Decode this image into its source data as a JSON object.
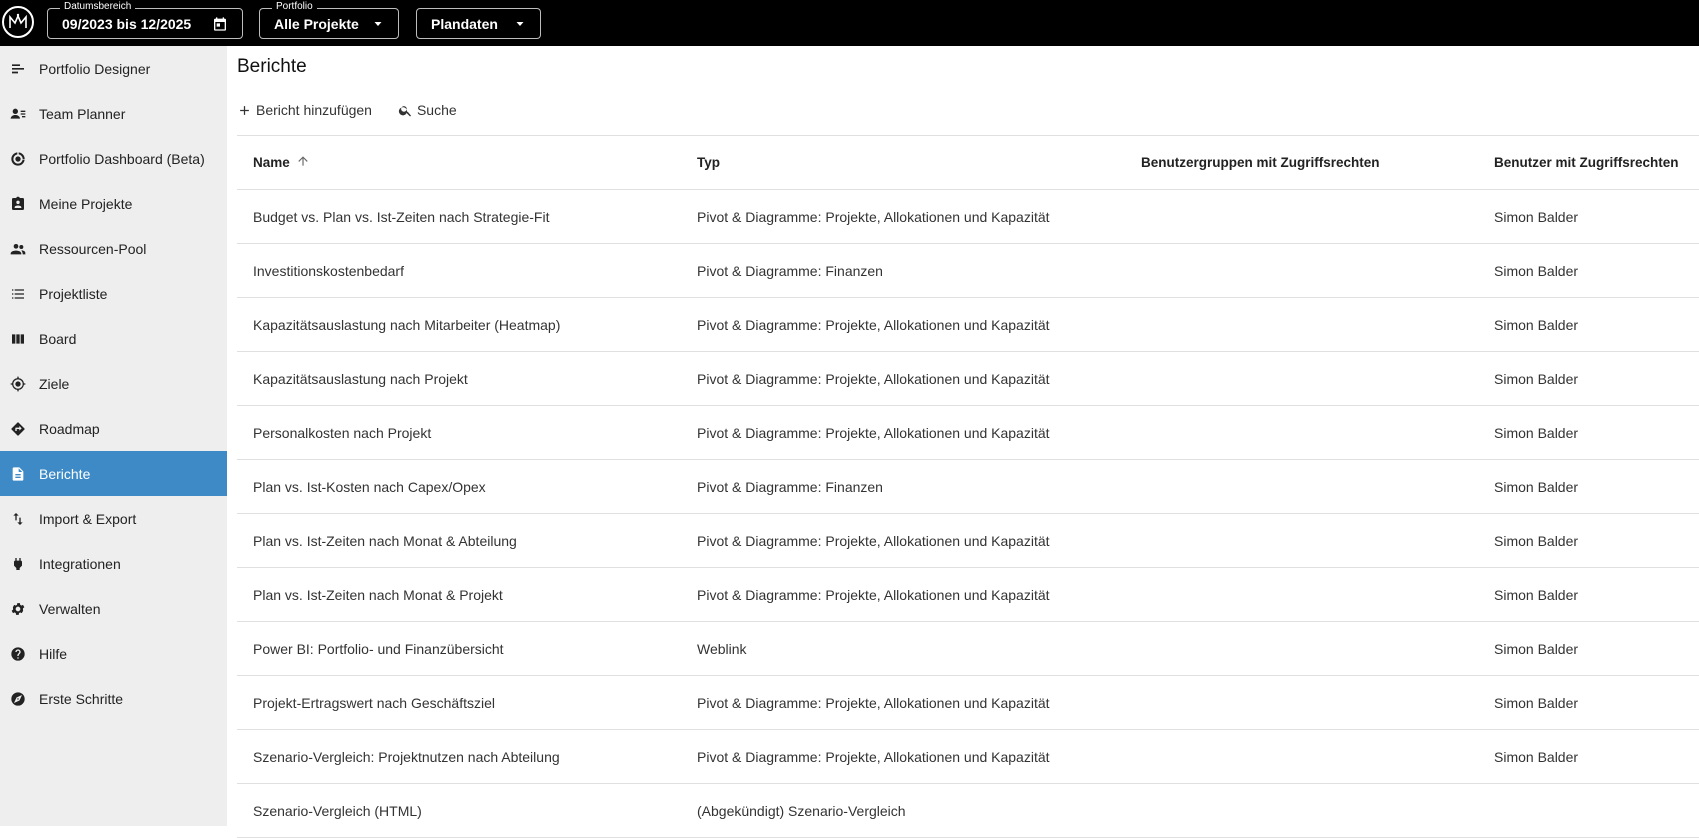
{
  "topbar": {
    "logo_icon": "monogram-logo-icon",
    "date_range": {
      "legend": "Datumsbereich",
      "value": "09/2023 bis 12/2025",
      "icon": "calendar-icon"
    },
    "portfolio": {
      "legend": "Portfolio",
      "value": "Alle Projekte",
      "icon": "dropdown-arrow-icon"
    },
    "plandata": {
      "value": "Plandaten",
      "icon": "dropdown-arrow-icon"
    }
  },
  "sidebar": {
    "items": [
      {
        "label": "Portfolio Designer",
        "icon": "portfolio-designer-icon"
      },
      {
        "label": "Team Planner",
        "icon": "team-planner-icon"
      },
      {
        "label": "Portfolio Dashboard (Beta)",
        "icon": "dashboard-icon"
      },
      {
        "label": "Meine Projekte",
        "icon": "my-projects-icon"
      },
      {
        "label": "Ressourcen-Pool",
        "icon": "people-icon"
      },
      {
        "label": "Projektliste",
        "icon": "list-icon"
      },
      {
        "label": "Board",
        "icon": "board-icon"
      },
      {
        "label": "Ziele",
        "icon": "target-icon"
      },
      {
        "label": "Roadmap",
        "icon": "roadmap-icon"
      },
      {
        "label": "Berichte",
        "icon": "report-icon",
        "active": true
      },
      {
        "label": "Import & Export",
        "icon": "import-export-icon"
      },
      {
        "label": "Integrationen",
        "icon": "plug-icon"
      },
      {
        "label": "Verwalten",
        "icon": "gear-icon"
      },
      {
        "label": "Hilfe",
        "icon": "help-icon"
      },
      {
        "label": "Erste Schritte",
        "icon": "compass-icon"
      }
    ],
    "active_color": "#3d8ac7"
  },
  "main": {
    "title": "Berichte",
    "toolbar": {
      "add_label": "Bericht hinzufügen",
      "search_label": "Suche"
    },
    "table": {
      "columns": [
        "Name",
        "Typ",
        "Benutzergruppen mit Zugriffsrechten",
        "Benutzer mit Zugriffsrechten"
      ],
      "sort": {
        "column": "Name",
        "direction": "ascending",
        "icon": "arrow-up-icon"
      },
      "rows": [
        {
          "name": "Budget vs. Plan vs. Ist-Zeiten nach Strategie-Fit",
          "type": "Pivot & Diagramme: Projekte, Allokationen und Kapazität",
          "groups": "",
          "users": "Simon Balder"
        },
        {
          "name": "Investitionskostenbedarf",
          "type": "Pivot & Diagramme: Finanzen",
          "groups": "",
          "users": "Simon Balder"
        },
        {
          "name": "Kapazitätsauslastung nach Mitarbeiter (Heatmap)",
          "type": "Pivot & Diagramme: Projekte, Allokationen und Kapazität",
          "groups": "",
          "users": "Simon Balder"
        },
        {
          "name": "Kapazitätsauslastung nach Projekt",
          "type": "Pivot & Diagramme: Projekte, Allokationen und Kapazität",
          "groups": "",
          "users": "Simon Balder"
        },
        {
          "name": "Personalkosten nach Projekt",
          "type": "Pivot & Diagramme: Projekte, Allokationen und Kapazität",
          "groups": "",
          "users": "Simon Balder"
        },
        {
          "name": "Plan vs. Ist-Kosten nach Capex/Opex",
          "type": "Pivot & Diagramme: Finanzen",
          "groups": "",
          "users": "Simon Balder"
        },
        {
          "name": "Plan vs. Ist-Zeiten nach Monat & Abteilung",
          "type": "Pivot & Diagramme: Projekte, Allokationen und Kapazität",
          "groups": "",
          "users": "Simon Balder"
        },
        {
          "name": "Plan vs. Ist-Zeiten nach Monat & Projekt",
          "type": "Pivot & Diagramme: Projekte, Allokationen und Kapazität",
          "groups": "",
          "users": "Simon Balder"
        },
        {
          "name": "Power BI: Portfolio- und Finanzübersicht",
          "type": "Weblink",
          "groups": "",
          "users": "Simon Balder"
        },
        {
          "name": "Projekt-Ertragswert nach Geschäftsziel",
          "type": "Pivot & Diagramme: Projekte, Allokationen und Kapazität",
          "groups": "",
          "users": "Simon Balder"
        },
        {
          "name": "Szenario-Vergleich: Projektnutzen nach Abteilung",
          "type": "Pivot & Diagramme: Projekte, Allokationen und Kapazität",
          "groups": "",
          "users": "Simon Balder"
        },
        {
          "name": "Szenario-Vergleich (HTML)",
          "type": "(Abgekündigt) Szenario-Vergleich",
          "groups": "",
          "users": ""
        }
      ]
    }
  }
}
